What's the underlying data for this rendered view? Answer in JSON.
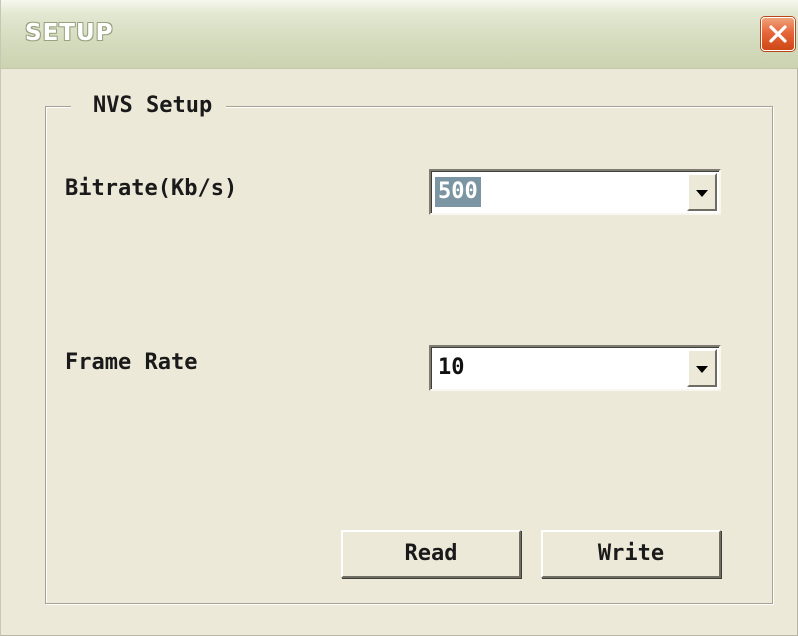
{
  "window": {
    "title": "SETUP"
  },
  "icons": {
    "close": "close-icon",
    "dropdown": "chevron-down-icon"
  },
  "colors": {
    "window_bg": "#ece9d8",
    "close_button": "#e5673b",
    "selection_highlight": "#7b95a2"
  },
  "group": {
    "title": "NVS Setup"
  },
  "bitrate": {
    "label": "Bitrate(Kb/s)",
    "value": "500"
  },
  "frame_rate": {
    "label": "Frame Rate",
    "value": "10"
  },
  "buttons": {
    "read": "Read",
    "write": "Write"
  }
}
